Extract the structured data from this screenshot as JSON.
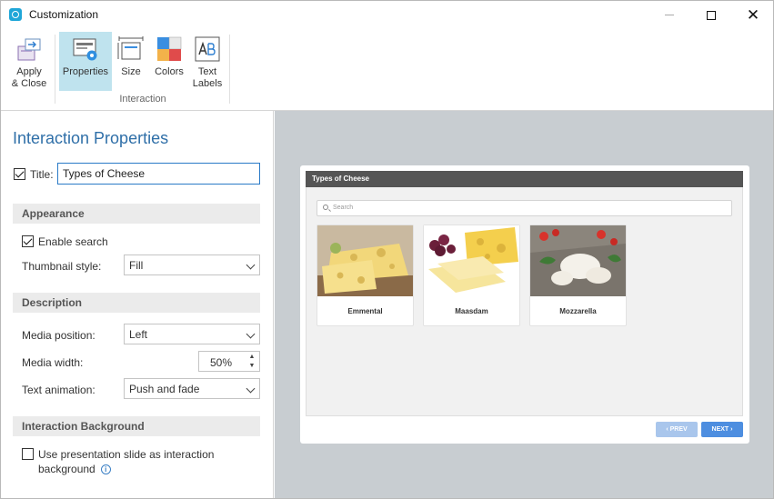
{
  "window": {
    "title": "Customization"
  },
  "ribbon": {
    "apply_label": "Apply\n& Close",
    "properties_label": "Properties",
    "size_label": "Size",
    "colors_label": "Colors",
    "text_labels_label": "Text\nLabels",
    "group_label": "Interaction"
  },
  "panel": {
    "title": "Interaction Properties",
    "title_label": "Title:",
    "title_value": "Types of Cheese",
    "title_checked": true,
    "appearance": {
      "header": "Appearance",
      "enable_search_label": "Enable search",
      "enable_search_checked": true,
      "thumbnail_style_label": "Thumbnail style:",
      "thumbnail_style_value": "Fill"
    },
    "description": {
      "header": "Description",
      "media_position_label": "Media position:",
      "media_position_value": "Left",
      "media_width_label": "Media width:",
      "media_width_value": "50%",
      "text_animation_label": "Text animation:",
      "text_animation_value": "Push and fade"
    },
    "background": {
      "header": "Interaction Background",
      "use_slide_label": "Use presentation slide as interaction background",
      "use_slide_checked": false
    }
  },
  "preview": {
    "header_title": "Types of Cheese",
    "search_placeholder": "Search",
    "items": [
      {
        "label": "Emmental"
      },
      {
        "label": "Maasdam"
      },
      {
        "label": "Mozzarella"
      }
    ],
    "prev_label": "‹ PREV",
    "next_label": "NEXT ›"
  },
  "colors": {
    "accent": "#2f6fa8",
    "ribbon_selected": "#bfe3ee",
    "preview_bg": "#c8cdd1",
    "next_button": "#4d8ee0",
    "prev_button_disabled": "#a9c6ec"
  }
}
